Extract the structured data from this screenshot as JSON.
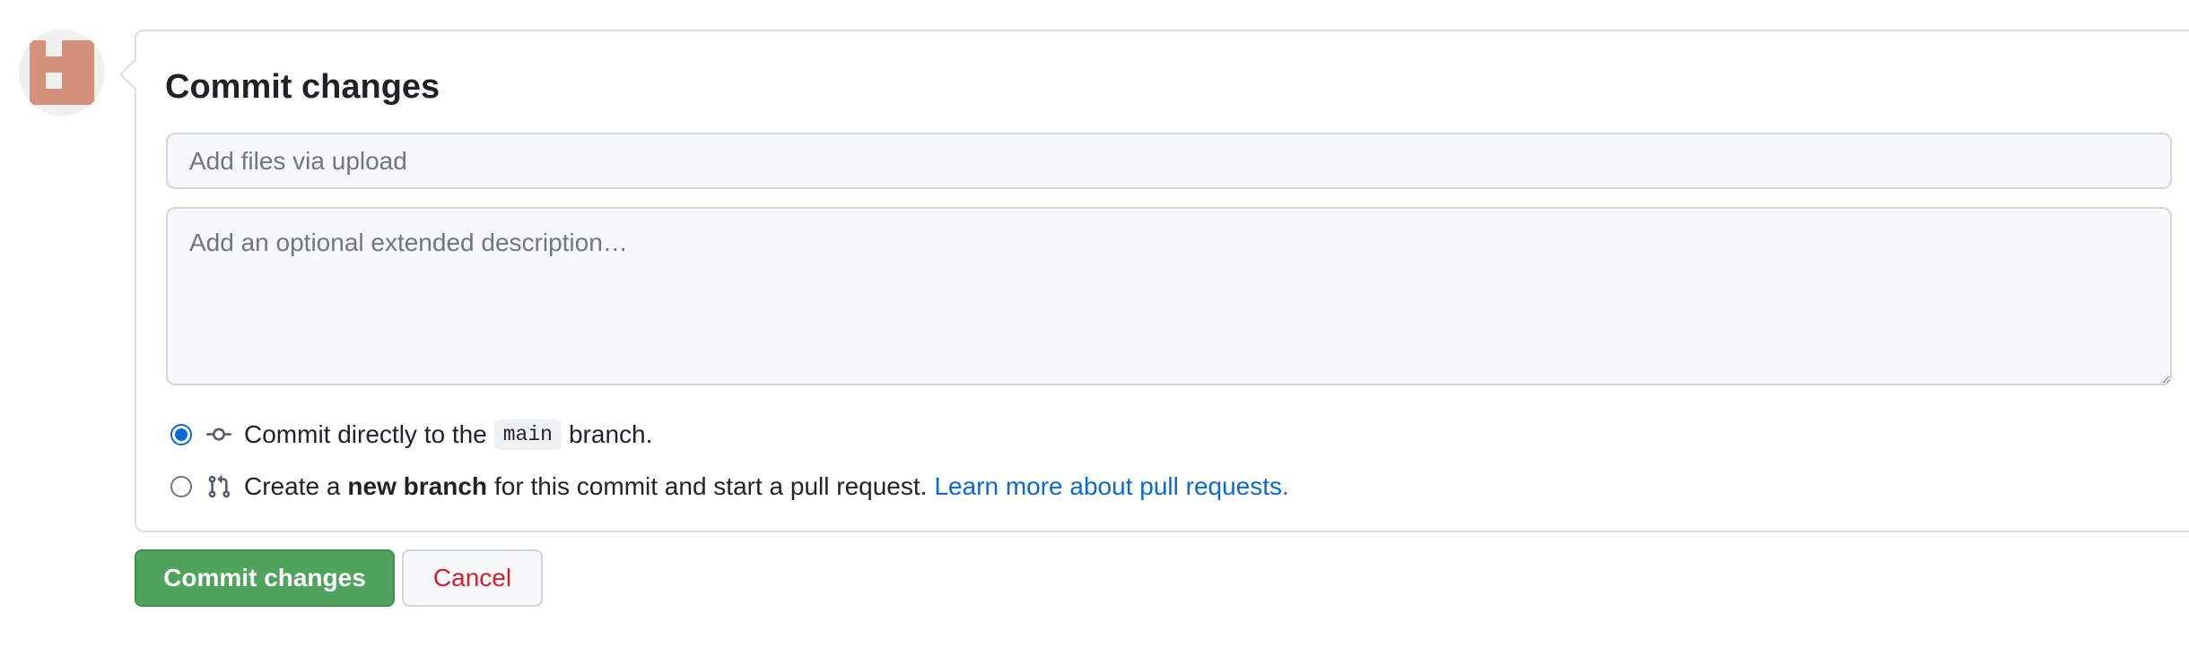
{
  "avatar": {
    "colors": {
      "bg": "#f0f0f0",
      "fg": "#d4907a"
    }
  },
  "form": {
    "title": "Commit changes",
    "summary_placeholder": "Add files via upload",
    "description_placeholder": "Add an optional extended description…",
    "options": [
      {
        "checked": true,
        "icon": "git-commit-icon",
        "text_before": "Commit directly to the",
        "branch": "main",
        "text_after": "branch."
      },
      {
        "checked": false,
        "icon": "git-pull-request-icon",
        "text_before": "Create a",
        "bold": "new branch",
        "text_after": "for this commit and start a pull request.",
        "link": "Learn more about pull requests."
      }
    ]
  },
  "buttons": {
    "commit_label": "Commit changes",
    "cancel_label": "Cancel"
  },
  "colors": {
    "accent": "#0969da",
    "commit_button": "#4fa35c",
    "cancel_text": "#cf222e",
    "border": "#d0d7de"
  }
}
